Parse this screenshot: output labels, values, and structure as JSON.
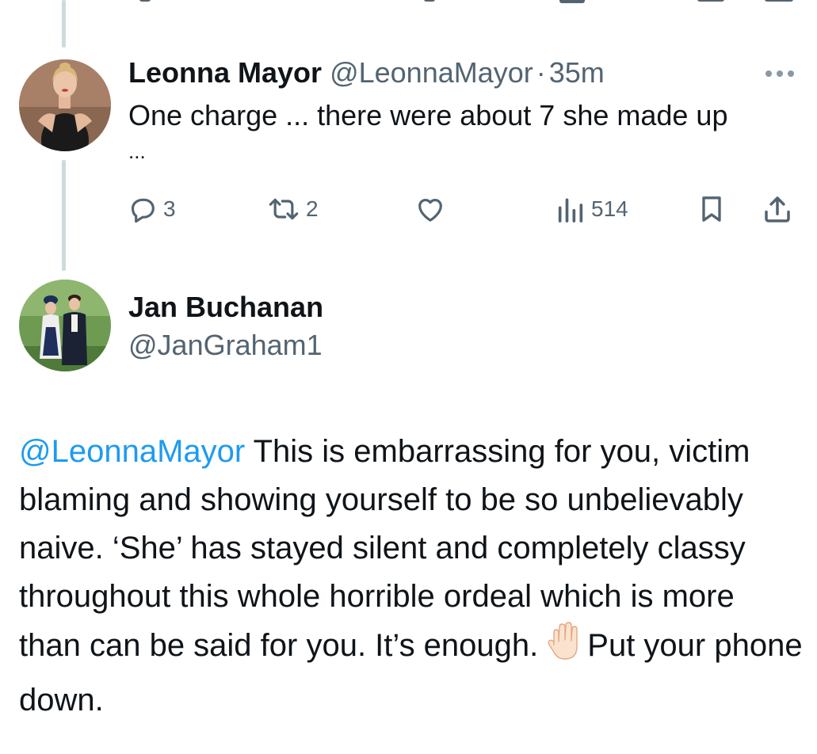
{
  "tweet": {
    "author": {
      "display_name": "Leonna Mayor",
      "handle": "@LeonnaMayor",
      "separator": "·",
      "time": "35m"
    },
    "text_line1": "One charge ... there were about 7 she made up",
    "text_line2": "...",
    "more_icon": "more-horizontal-icon",
    "actions": {
      "reply": {
        "icon": "reply-icon",
        "count": "3"
      },
      "retweet": {
        "icon": "retweet-icon",
        "count": "2"
      },
      "like": {
        "icon": "heart-icon",
        "count": ""
      },
      "views": {
        "icon": "views-icon",
        "count": "514"
      },
      "bookmark": {
        "icon": "bookmark-icon"
      },
      "share": {
        "icon": "share-icon"
      }
    }
  },
  "reply": {
    "author": {
      "display_name": "Jan Buchanan",
      "handle": "@JanGraham1"
    },
    "mention": "@LeonnaMayor",
    "text_part1": " This is embarrassing for you, victim blaming and showing yourself to be so unbelievably naive. ‘She’ has stayed silent and completely classy throughout this whole horrible ordeal which is more than can be said for you. It’s enough.",
    "emoji_icon": "raised-hand-emoji-icon",
    "text_part2": "Put your phone down."
  },
  "colors": {
    "text": "#0f1419",
    "secondary": "#536471",
    "link": "#1d9bf0",
    "thread_line": "#cfd9de",
    "background": "#ffffff"
  }
}
